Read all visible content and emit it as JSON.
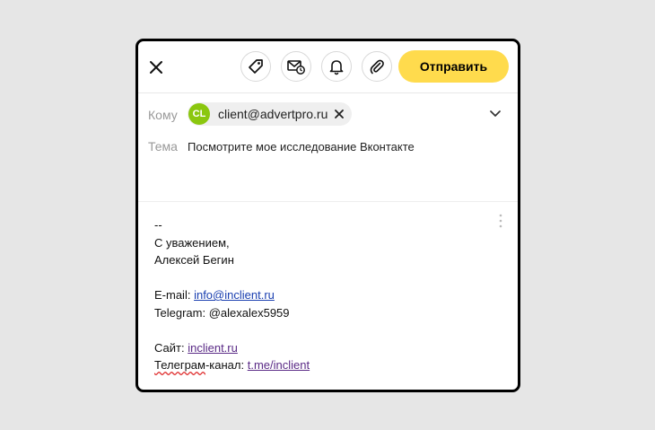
{
  "toolbar": {
    "send_label": "Отправить",
    "icons": [
      "close-icon",
      "tag-icon",
      "mail-schedule-icon",
      "bell-icon",
      "paperclip-icon"
    ]
  },
  "recipients": {
    "label": "Кому",
    "chip": {
      "initials": "CL",
      "email": "client@advertpro.ru"
    }
  },
  "subject": {
    "label": "Тема",
    "value": "Посмотрите мое исследование Вконтакте"
  },
  "signature": {
    "dashes": "--",
    "greeting": "С уважением,",
    "name": "Алексей Бегин",
    "email_label": "E-mail:",
    "email_link": "info@inclient.ru",
    "telegram_line": "Telegram: @alexalex5959",
    "site_label": "Сайт:",
    "site_link": "inclient.ru",
    "channel_word": "Телеграм",
    "channel_rest": "-канал:",
    "channel_link": "t.me/inclient"
  },
  "colors": {
    "accent": "#ffdb4d",
    "avatar": "#8bc70f",
    "link": "#1a3fb0",
    "visited_link": "#5a2a86"
  }
}
